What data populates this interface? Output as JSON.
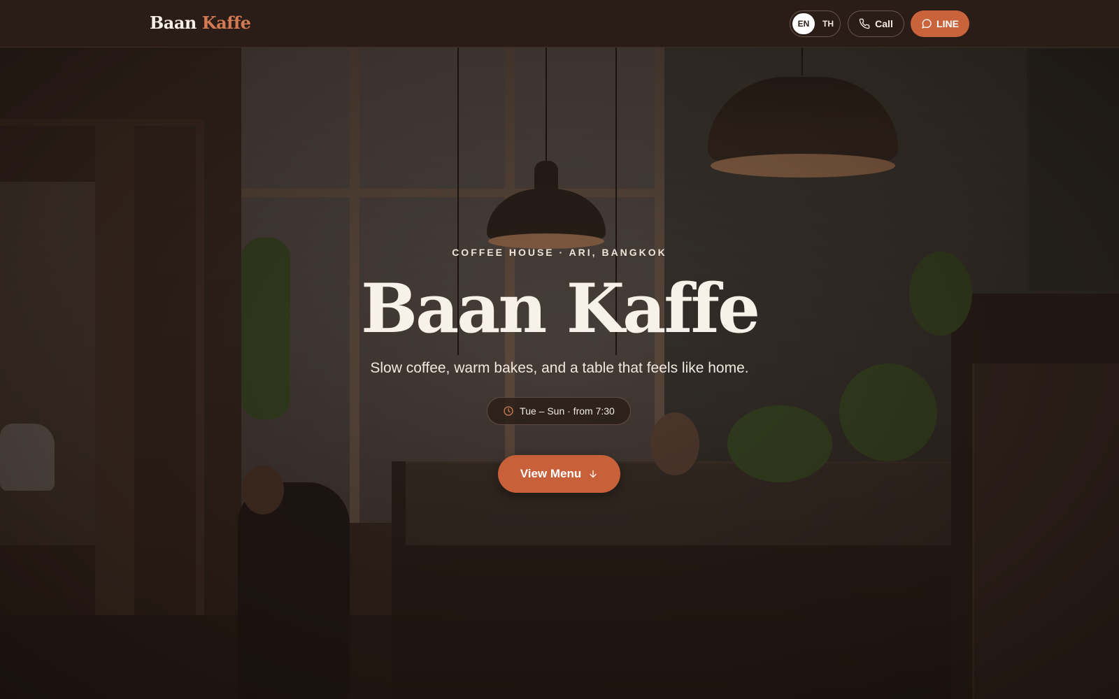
{
  "brand": {
    "part1": "Baan",
    "part2": "Kaffe"
  },
  "nav": {
    "lang_en": "EN",
    "lang_th": "TH",
    "call_label": "Call",
    "line_label": "LINE",
    "call_icon": "phone-icon",
    "line_icon": "chat-bubble-icon"
  },
  "hero": {
    "eyebrow": "COFFEE HOUSE · ARI, BANGKOK",
    "title": "Baan Kaffe",
    "subtitle": "Slow coffee, warm bakes, and a table that feels like home.",
    "hours": "Tue – Sun · from 7:30",
    "hours_icon": "clock-icon",
    "cta_label": "View Menu",
    "cta_icon": "arrow-down-icon"
  },
  "colors": {
    "accent": "#c8613a",
    "nav_bg": "#2a1c16",
    "brand_accent": "#d27b52"
  }
}
